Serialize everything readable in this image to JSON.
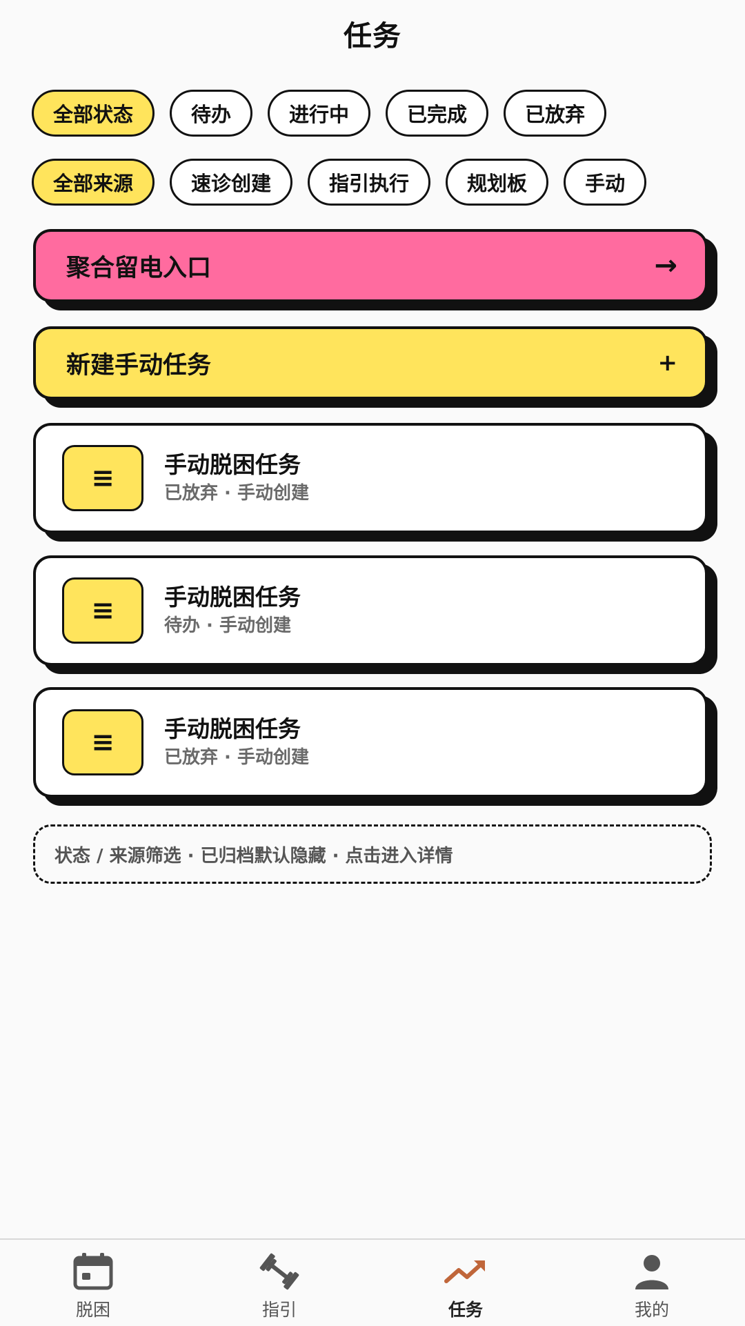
{
  "header": {
    "title": "任务"
  },
  "status_filters": [
    {
      "label": "全部状态",
      "active": true
    },
    {
      "label": "待办",
      "active": false
    },
    {
      "label": "进行中",
      "active": false
    },
    {
      "label": "已完成",
      "active": false
    },
    {
      "label": "已放弃",
      "active": false
    }
  ],
  "source_filters": [
    {
      "label": "全部来源",
      "active": true
    },
    {
      "label": "速诊创建",
      "active": false
    },
    {
      "label": "指引执行",
      "active": false
    },
    {
      "label": "规划板",
      "active": false
    },
    {
      "label": "手动",
      "active": false
    }
  ],
  "entry_banner": {
    "label": "聚合留电入口",
    "icon": "arrow-right-icon",
    "color": "#ff6b9f"
  },
  "new_task": {
    "label": "新建手动任务",
    "icon": "plus-icon",
    "color": "#ffe45c"
  },
  "tasks": [
    {
      "title": "手动脱困任务",
      "subtitle": "已放弃 · 手动创建",
      "icon": "menu-icon"
    },
    {
      "title": "手动脱困任务",
      "subtitle": "待办 · 手动创建",
      "icon": "menu-icon"
    },
    {
      "title": "手动脱困任务",
      "subtitle": "已放弃 · 手动创建",
      "icon": "menu-icon"
    }
  ],
  "hint": "状态 / 来源筛选 · 已归档默认隐藏 · 点击进入详情",
  "bottom_nav": [
    {
      "label": "脱困",
      "icon": "calendar-icon",
      "active": false
    },
    {
      "label": "指引",
      "icon": "dumbbell-icon",
      "active": false
    },
    {
      "label": "任务",
      "icon": "trend-icon",
      "active": true,
      "color": "#c0663a"
    },
    {
      "label": "我的",
      "icon": "person-icon",
      "active": false
    }
  ]
}
